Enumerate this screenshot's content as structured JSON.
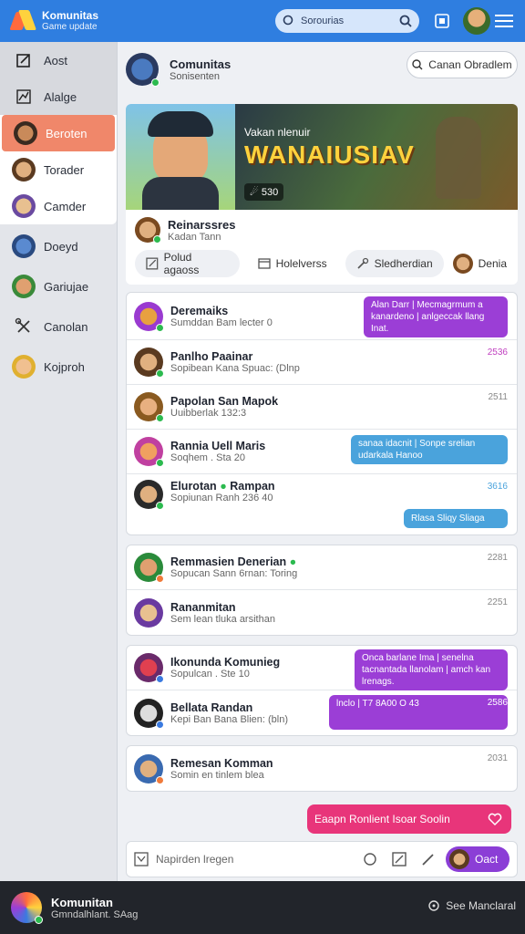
{
  "app": {
    "title": "Komunitas",
    "subtitle": "Game update"
  },
  "search": {
    "placeholder": "Sorourias"
  },
  "sidebar": {
    "items": [
      {
        "label": "Aost"
      },
      {
        "label": "Alalge"
      },
      {
        "label": "Beroten"
      },
      {
        "label": "Torader"
      },
      {
        "label": "Camder"
      },
      {
        "label": "Doeyd"
      },
      {
        "label": "Gariujae"
      },
      {
        "label": "Canolan"
      },
      {
        "label": "Kojproh"
      }
    ]
  },
  "header": {
    "title": "Comunitas",
    "subtitle": "Sonisenten"
  },
  "find_button": {
    "label": "Canan Obradlem"
  },
  "banner": {
    "small_title": "Vakan nlenuir",
    "big_title": "WANAIUSIAV",
    "badge": "☄ 530"
  },
  "post": {
    "title": "Reinarssres",
    "subtitle": "Kadan Tann",
    "actions": [
      "Polud agaoss",
      "Holelverss",
      "Sledherdian",
      "Denia"
    ]
  },
  "group1": [
    {
      "name": "Deremaiks",
      "msg": "Sumddan Bam lecter",
      "extra": "0",
      "time": "",
      "bubble": "Alan Darr | Mecmagrmum a kanardeno | anlgeccak llang Inat.",
      "bubble_color": "purple"
    },
    {
      "name": "Panlho Paainar",
      "msg": "Sopibean Kana Spuac: (Dlnp",
      "time": "2536"
    },
    {
      "name": "Papolan San Mapok",
      "msg": "Uuibberlak 132:3",
      "time": "2511"
    },
    {
      "name": "Rannia Uell Maris",
      "msg": "Soqhem . Sta 20",
      "time": "",
      "bubble": "sanaa idacnit | Sonpe srelian udarkala Hanoo",
      "bubble_color": "blue"
    },
    {
      "name": "Elurotan",
      "name2": "Rampan",
      "msg": "Sopiunan Ranh 236 40",
      "time": "3616",
      "bubble": "Rlasa Sliqy Sliaga",
      "bubble_color": "blue"
    }
  ],
  "group2": [
    {
      "name": "Remmasien Denerian",
      "msg": "Sopucan Sann 6rnan: Toring",
      "time": "2281"
    },
    {
      "name": "Rananmitan",
      "msg": "Sem lean tluka arsithan",
      "time": "2251"
    }
  ],
  "group3": [
    {
      "name": "Ikonunda Komunieg",
      "msg": "Sopulcan . Ste 10",
      "time": "",
      "bubble": "Onca barlane Ima | senelna tacnantada llanolam | amch kan lrenags.",
      "bubble_color": "purple"
    },
    {
      "name": "Bellata Randan",
      "msg": "Kepi Ban Bana Blien: (bln)",
      "time": "2586",
      "bubble": "lnclo | T7 8A00 O  43",
      "bubble_color": "purple"
    }
  ],
  "group4": [
    {
      "name": "Remesan Komman",
      "msg": "Somin en tinlem blea",
      "time": "2031"
    }
  ],
  "cta": {
    "label": "Eaapn Ronlient Isoar Soolin"
  },
  "composer": {
    "placeholder": "Napirden lregen",
    "send_label": "Oact"
  },
  "footer": {
    "name": "Komunitan",
    "sub": "Gmndalhlant. SAag",
    "see_label": "See Manclaral"
  },
  "colors": {
    "primary": "#2f7ee0",
    "accent": "#e8357a",
    "purple": "#9b3ed6",
    "blue": "#4aa3dc",
    "sidebar_active": "#f0876a"
  }
}
